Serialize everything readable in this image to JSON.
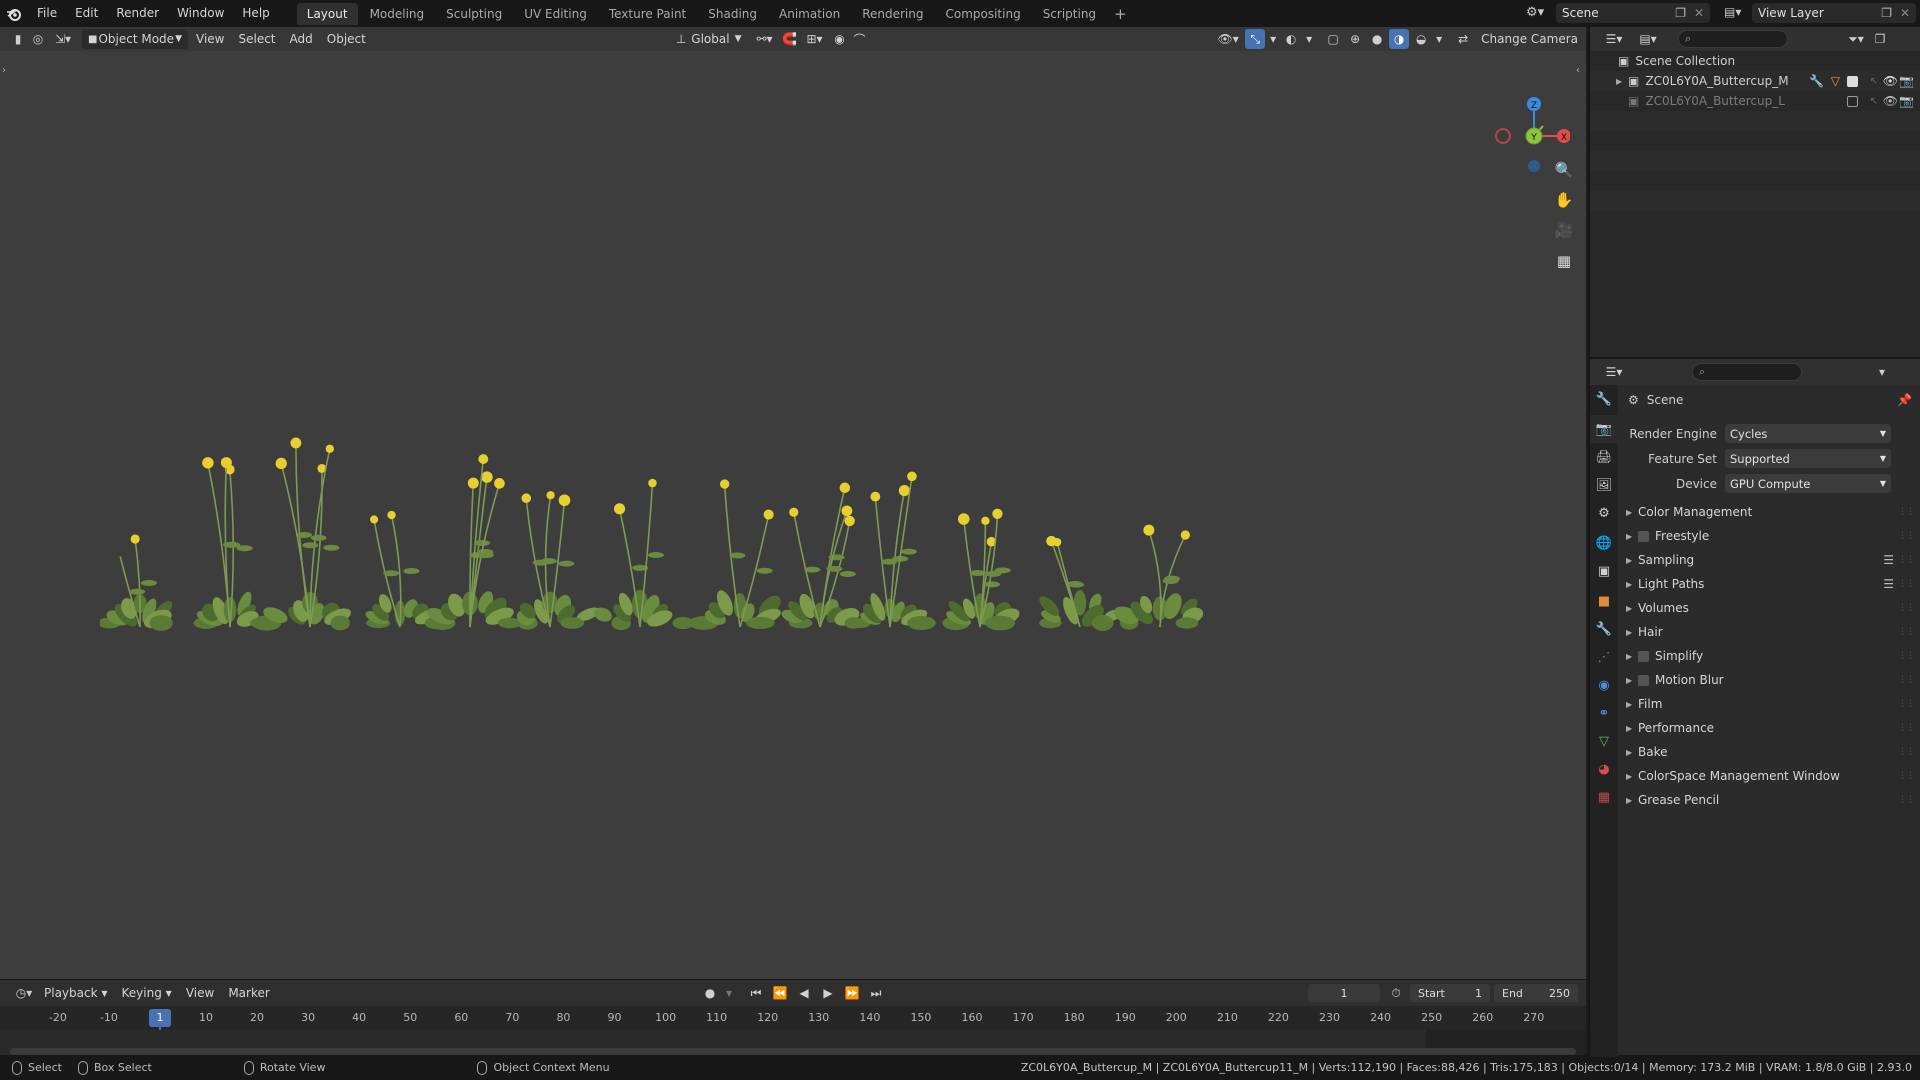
{
  "topbar": {
    "menu": [
      "File",
      "Edit",
      "Render",
      "Window",
      "Help"
    ],
    "workspaces": [
      "Layout",
      "Modeling",
      "Sculpting",
      "UV Editing",
      "Texture Paint",
      "Shading",
      "Animation",
      "Rendering",
      "Compositing",
      "Scripting"
    ],
    "active_workspace": "Layout",
    "add_workspace": "+",
    "scene_name": "Scene",
    "view_layer_name": "View Layer"
  },
  "viewport_header": {
    "mode": "Object Mode",
    "menus": [
      "View",
      "Select",
      "Add",
      "Object"
    ],
    "transform_orientation": "Global",
    "change_camera": "Change Camera"
  },
  "gizmo": {
    "z": "Z",
    "x": "X",
    "y": "Y"
  },
  "timeline": {
    "menus": [
      "Playback",
      "Keying",
      "View",
      "Marker"
    ],
    "current_frame": "1",
    "start_label": "Start",
    "start_value": "1",
    "end_label": "End",
    "end_value": "250",
    "ticks": [
      "-20",
      "-10",
      "1",
      "10",
      "20",
      "30",
      "40",
      "50",
      "60",
      "70",
      "80",
      "90",
      "100",
      "110",
      "120",
      "130",
      "140",
      "150",
      "160",
      "170",
      "180",
      "190",
      "200",
      "210",
      "220",
      "230",
      "240",
      "250",
      "260",
      "270"
    ],
    "playhead_label": "1"
  },
  "statusbar": {
    "select": "Select",
    "box_select": "Box Select",
    "rotate_view": "Rotate View",
    "context_menu": "Object Context Menu",
    "stats": "ZC0L6Y0A_Buttercup_M | ZC0L6Y0A_Buttercup11_M | Verts:112,190 | Faces:88,426 | Tris:175,183 | Objects:0/14 | Memory: 173.2 MiB | VRAM: 1.8/8.0 GiB | 2.93.0"
  },
  "outliner": {
    "root": "Scene Collection",
    "items": [
      {
        "name": "ZC0L6Y0A_Buttercup_M",
        "enabled": true
      },
      {
        "name": "ZC0L6Y0A_Buttercup_L",
        "enabled": false
      }
    ]
  },
  "properties": {
    "context": "Scene",
    "fields": [
      {
        "label": "Render Engine",
        "value": "Cycles"
      },
      {
        "label": "Feature Set",
        "value": "Supported"
      },
      {
        "label": "Device",
        "value": "GPU Compute"
      }
    ],
    "panels": [
      {
        "label": "Color Management",
        "checkbox": false,
        "list": false
      },
      {
        "label": "Freestyle",
        "checkbox": true,
        "list": false
      },
      {
        "label": "Sampling",
        "checkbox": false,
        "list": true
      },
      {
        "label": "Light Paths",
        "checkbox": false,
        "list": true
      },
      {
        "label": "Volumes",
        "checkbox": false,
        "list": false
      },
      {
        "label": "Hair",
        "checkbox": false,
        "list": false
      },
      {
        "label": "Simplify",
        "checkbox": true,
        "list": false
      },
      {
        "label": "Motion Blur",
        "checkbox": true,
        "list": false
      },
      {
        "label": "Film",
        "checkbox": false,
        "list": false
      },
      {
        "label": "Performance",
        "checkbox": false,
        "list": false
      },
      {
        "label": "Bake",
        "checkbox": false,
        "list": false
      },
      {
        "label": "ColorSpace Management Window",
        "checkbox": false,
        "list": false
      },
      {
        "label": "Grease Pencil",
        "checkbox": false,
        "list": false
      }
    ],
    "tabs": [
      "tool-icon",
      "render-icon",
      "output-icon",
      "view-layer-icon",
      "scene-icon",
      "world-icon",
      "collection-icon",
      "object-icon",
      "modifier-icon",
      "particles-icon",
      "physics-icon",
      "constraints-icon",
      "data-icon",
      "material-icon",
      "texture-icon"
    ]
  },
  "colors": {
    "accent": "#4772b3",
    "viewport_bg": "#3d3d3d",
    "axis_x": "#e04c4c",
    "axis_y": "#8cc43c",
    "axis_z": "#3d8ae0"
  }
}
